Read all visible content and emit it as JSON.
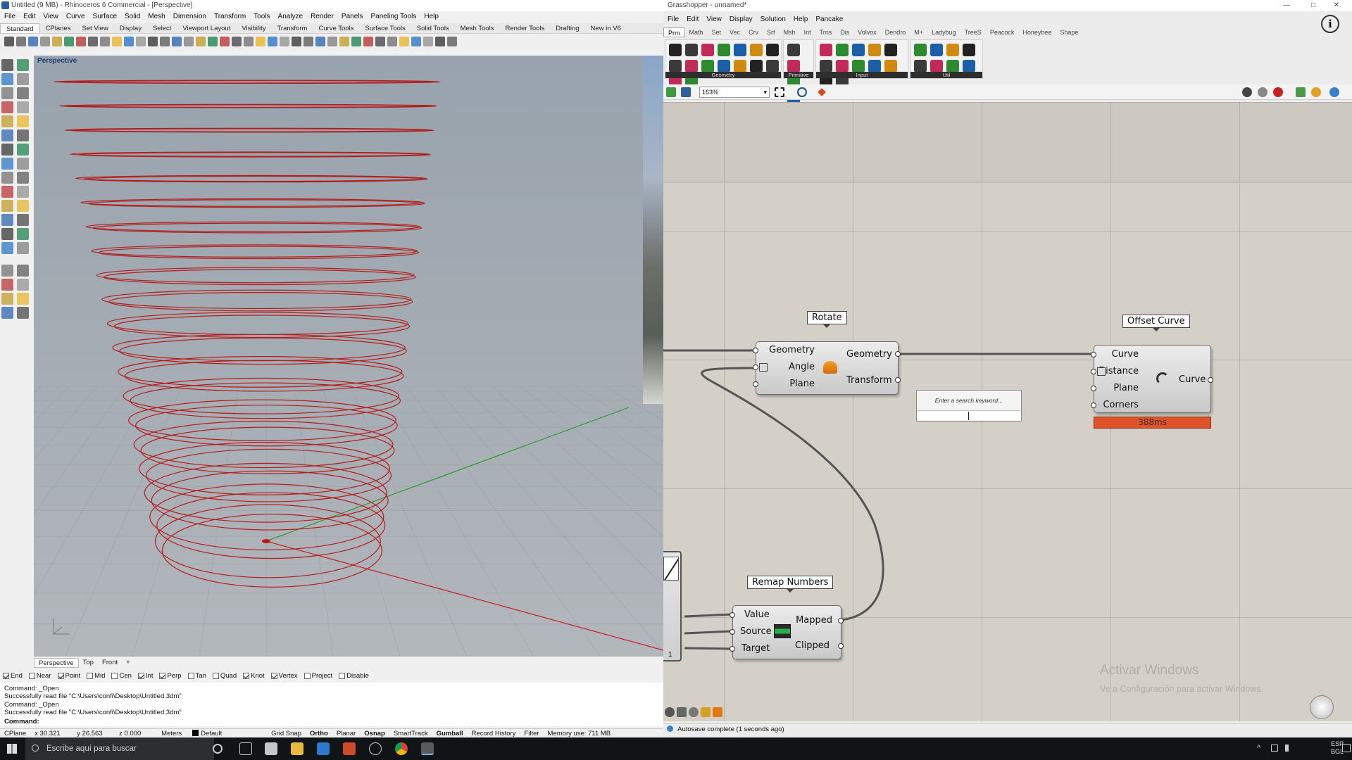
{
  "rhino": {
    "title": "Untitled (9 MB) - Rhinoceros 6 Commercial - [Perspective]",
    "menu": [
      "File",
      "Edit",
      "View",
      "Curve",
      "Surface",
      "Solid",
      "Mesh",
      "Dimension",
      "Transform",
      "Tools",
      "Analyze",
      "Render",
      "Panels",
      "Paneling Tools",
      "Help"
    ],
    "tabs": [
      "Standard",
      "CPlanes",
      "Set View",
      "Display",
      "Select",
      "Viewport Layout",
      "Visibility",
      "Transform",
      "Curve Tools",
      "Surface Tools",
      "Solid Tools",
      "Mesh Tools",
      "Render Tools",
      "Drafting",
      "New in V6"
    ],
    "active_tab": "Standard",
    "viewport_label": "Perspective",
    "viewport_tabs": [
      "Perspective",
      "Top",
      "Front"
    ],
    "add_tab": "+",
    "osnaps": [
      {
        "label": "End",
        "on": true
      },
      {
        "label": "Near",
        "on": false
      },
      {
        "label": "Point",
        "on": true
      },
      {
        "label": "Mid",
        "on": false
      },
      {
        "label": "Cen",
        "on": false
      },
      {
        "label": "Int",
        "on": true
      },
      {
        "label": "Perp",
        "on": true
      },
      {
        "label": "Tan",
        "on": false
      },
      {
        "label": "Quad",
        "on": false
      },
      {
        "label": "Knot",
        "on": true
      },
      {
        "label": "Vertex",
        "on": true
      },
      {
        "label": "Project",
        "on": false
      },
      {
        "label": "Disable",
        "on": false
      }
    ],
    "command_history": [
      "Command: _Open",
      "Successfully read file \"C:\\Users\\confi\\Desktop\\Untitled.3dm\"",
      "Command: _Open",
      "Successfully read file \"C:\\Users\\confi\\Desktop\\Untitled.3dm\""
    ],
    "command_prompt": "Command:",
    "status": {
      "cplane": "CPlane",
      "x": "x 30.321",
      "y": "y 26.563",
      "z": "z 0.000",
      "units": "Meters",
      "layer": "Default",
      "grid_snap": "Grid Snap",
      "ortho": "Ortho",
      "planar": "Planar",
      "osnap": "Osnap",
      "smarttrack": "SmartTrack",
      "gumball": "Gumball",
      "record_history": "Record History",
      "filter": "Filter",
      "memory": "Memory use: 711 MB"
    },
    "colors": {
      "curve": "#b31d1d",
      "x_axis": "#c02020",
      "y_axis": "#2f9b2f"
    }
  },
  "gh": {
    "title": "Grasshopper - unnamed*",
    "menu": [
      "File",
      "Edit",
      "View",
      "Display",
      "Solution",
      "Help",
      "Pancake"
    ],
    "tabs": [
      "Prm",
      "Math",
      "Set",
      "Vec",
      "Crv",
      "Srf",
      "Msh",
      "Int",
      "Trns",
      "Dis",
      "Volvox",
      "Dendro",
      "M+",
      "Ladybug",
      "TreeS",
      "Peacock",
      "Honeybee",
      "Shape"
    ],
    "active_tab": "Prm",
    "groups": [
      "Geometry",
      "Primitive",
      "Input",
      "Util"
    ],
    "zoom": "163%",
    "rotate": {
      "title": "Rotate",
      "inputs": [
        "Geometry",
        "Angle",
        "Plane"
      ],
      "outputs": [
        "Geometry",
        "Transform"
      ]
    },
    "offset": {
      "title": "Offset Curve",
      "inputs": [
        "Curve",
        "Distance",
        "Plane",
        "Corners"
      ],
      "outputs": [
        "Curve"
      ],
      "runtime": "388ms"
    },
    "remap": {
      "title": "Remap Numbers",
      "inputs": [
        "Value",
        "Source",
        "Target"
      ],
      "outputs": [
        "Mapped",
        "Clipped"
      ]
    },
    "search_placeholder": "Enter a search keyword...",
    "partial_label": "1",
    "watermark_title": "Activar Windows",
    "watermark_sub": "Ve a Configuración para activar Windows.",
    "status": "Autosave complete (1 seconds ago)",
    "colors": {
      "warning": "#e0522a",
      "wire": "#555555"
    }
  },
  "taskbar": {
    "search_placeholder": "Escribe aquí para buscar",
    "lang": "ESP",
    "lang2": "BGL"
  }
}
